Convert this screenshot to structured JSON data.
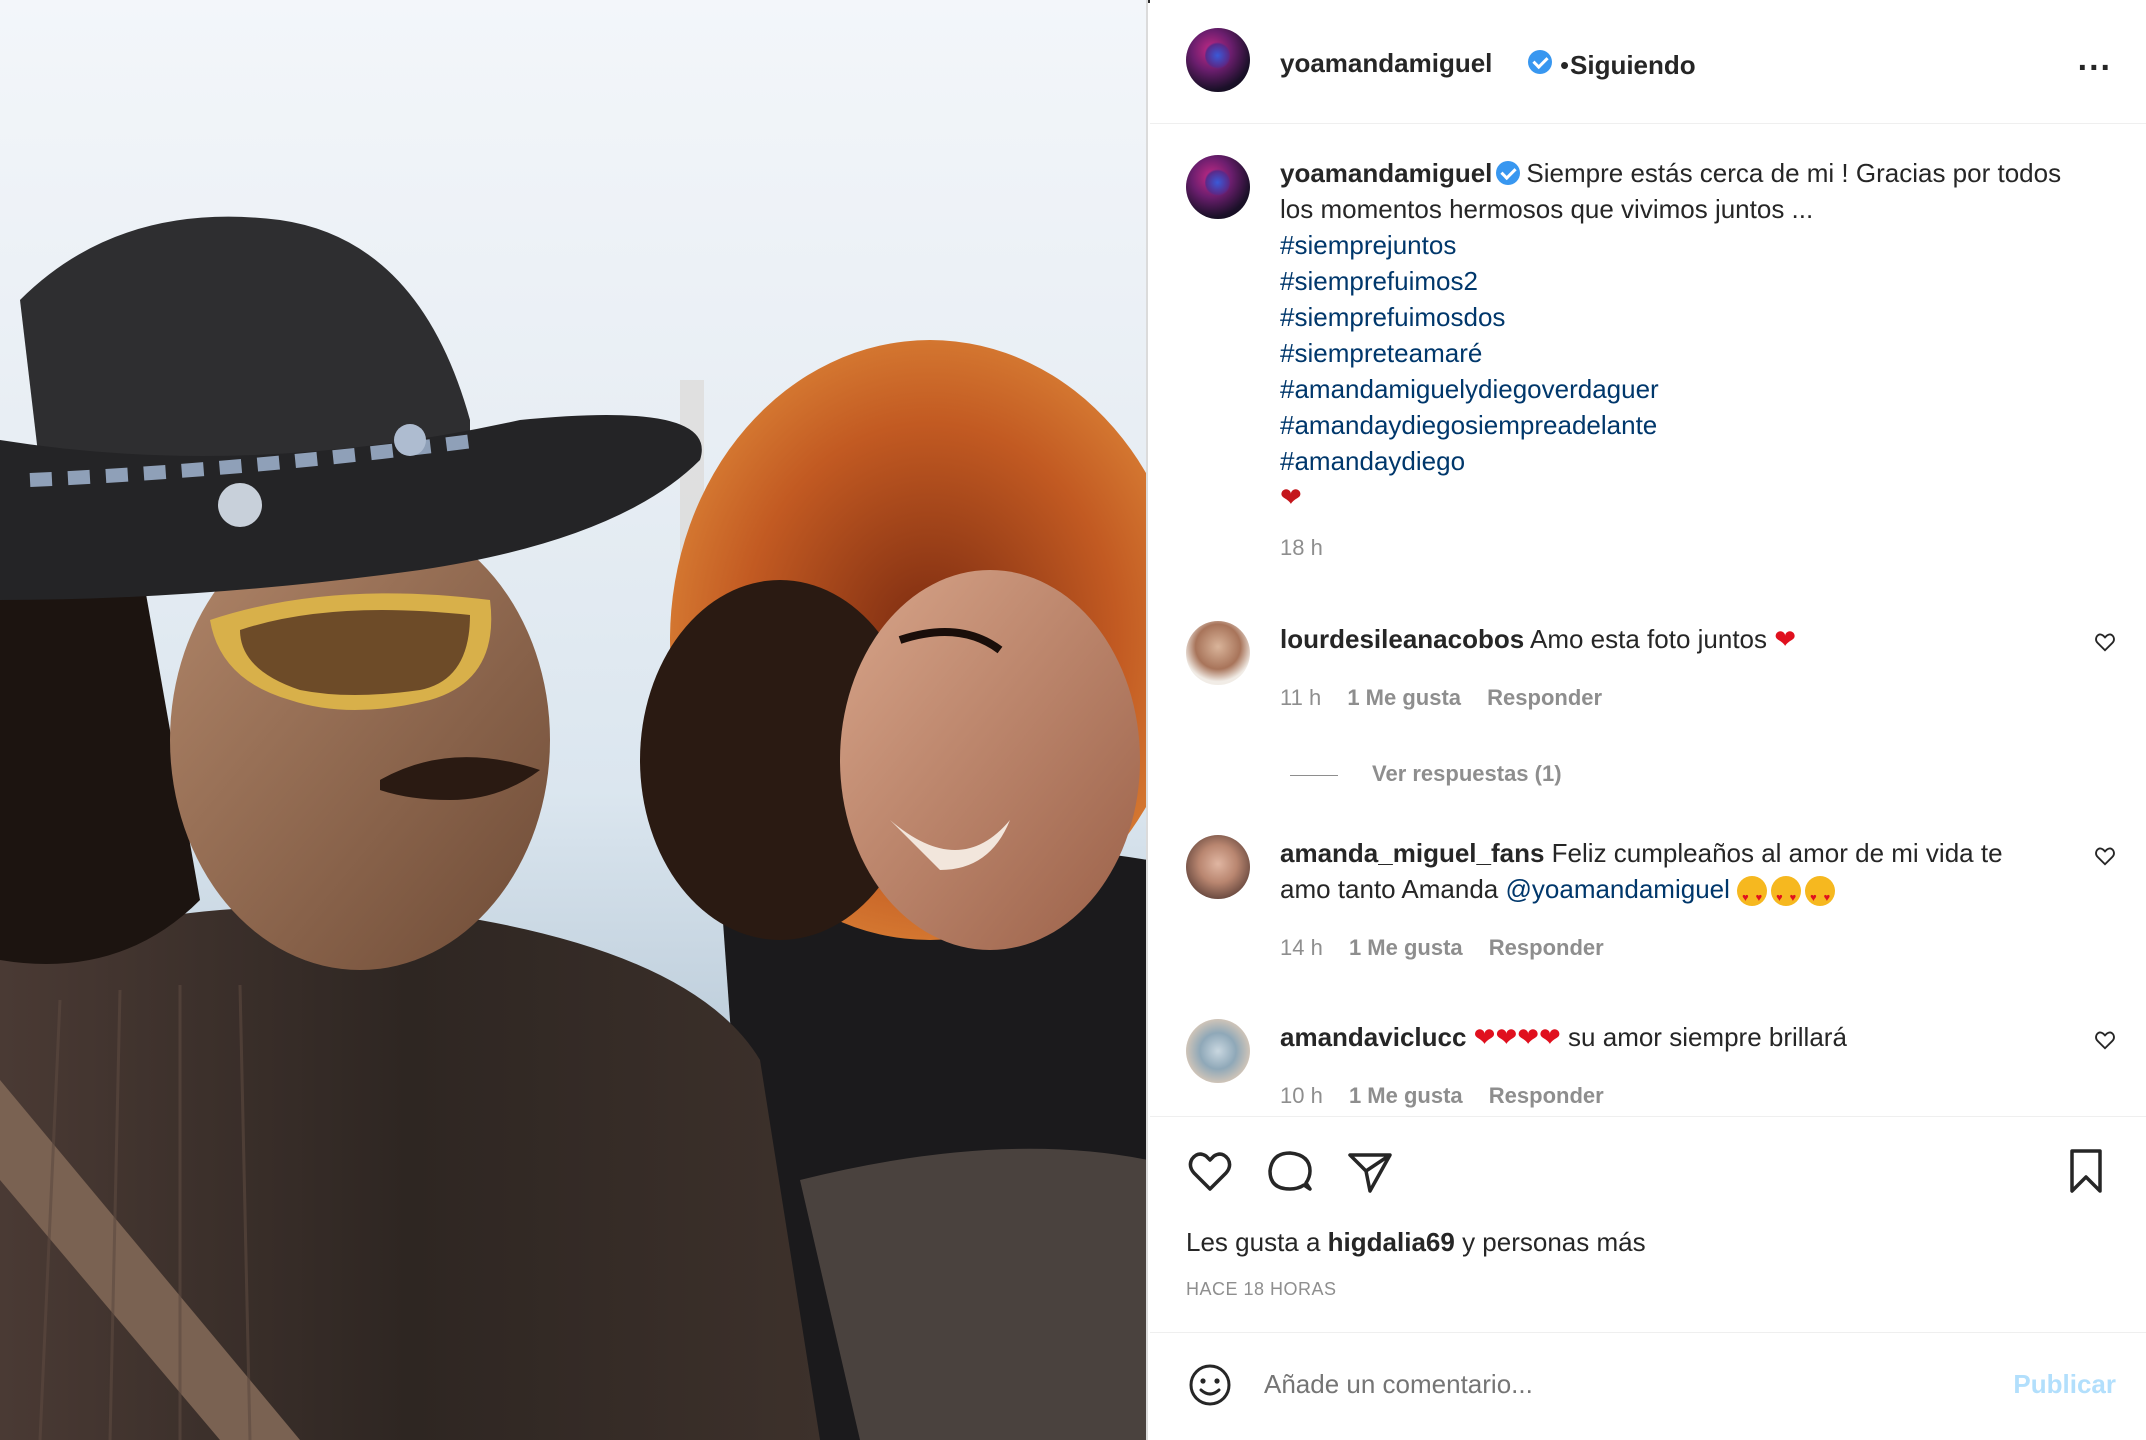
{
  "post": {
    "username": "yoamandamiguel",
    "follow_status": "Siguiendo",
    "dot": "•",
    "more": "...",
    "caption_text": "Siempre estás cerca de mi ! Gracias por todos los momentos hermosos que vivimos juntos ...",
    "hashtags": [
      "#siemprejuntos",
      "#siemprefuimos2",
      "#siemprefuimosdos",
      "#siempreteamaré",
      "#amandamiguelydiegoverdaguer",
      "#amandaydiegosiempreadelante",
      "#amandaydiego"
    ],
    "caption_emoji": "❤",
    "caption_time": "18 h"
  },
  "comments": [
    {
      "username": "lourdesileanacobos",
      "text": "Amo esta foto juntos",
      "emoji": "❤",
      "time": "11 h",
      "likes": "1 Me gusta",
      "reply": "Responder",
      "replies_toggle": "Ver respuestas (1)"
    },
    {
      "username": "amanda_miguel_fans",
      "text": "Feliz cumpleaños al amor de mi vida te amo tanto Amanda",
      "mention": "@yoamandamiguel",
      "time": "14 h",
      "likes": "1 Me gusta",
      "reply": "Responder"
    },
    {
      "username": "amandaviclucc",
      "emoji": "❤❤❤❤",
      "text": "su amor siempre brillará",
      "time": "10 h",
      "likes": "1 Me gusta",
      "reply": "Responder"
    }
  ],
  "actions": {
    "likes_prefix": "Les gusta a",
    "likes_user": "higdalia69",
    "likes_suffix": "y personas más",
    "time_ago": "HACE 18 HORAS"
  },
  "add_comment": {
    "placeholder": "Añade un comentario...",
    "post_label": "Publicar"
  },
  "colors": {
    "accent": "#0095f6",
    "hashtag": "#00376b",
    "secondary_text": "#8e8e8e",
    "post_disabled": "#b2dffc",
    "verified": "#3897f0"
  }
}
